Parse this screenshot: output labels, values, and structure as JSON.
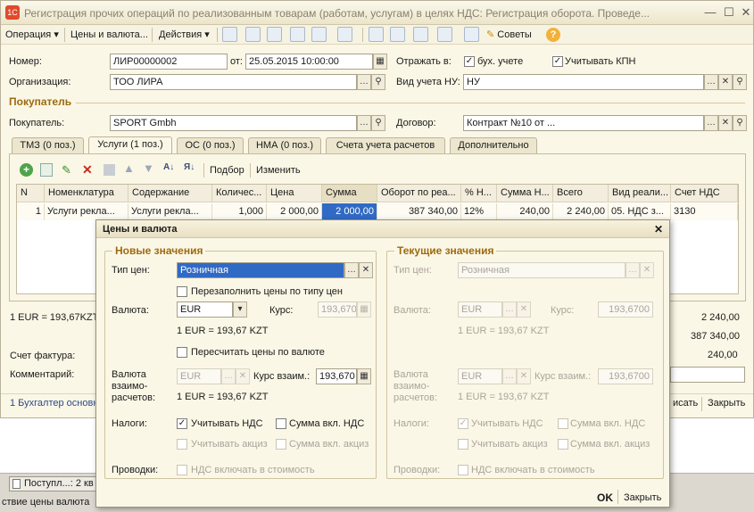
{
  "window": {
    "title": "Регистрация прочих операций по реализованным товарам (работам, услугам) в целях НДС: Регистрация оборота. Проведе...",
    "controls": {
      "minimize": "—",
      "maximize": "☐",
      "close": "✕"
    }
  },
  "toolbar": {
    "operation": "Операция",
    "prices": "Цены и валюта...",
    "actions": "Действия",
    "advice": "Советы",
    "help": "?"
  },
  "header": {
    "number_label": "Номер:",
    "number_value": "ЛИР00000002",
    "from_label": "от:",
    "date_value": "25.05.2015 10:00:00",
    "reflect_label": "Отражать в:",
    "bu_label": "бух. учете",
    "kpn_label": "Учитывать КПН",
    "org_label": "Организация:",
    "org_value": "ТОО ЛИРА",
    "nu_label": "Вид учета НУ:",
    "nu_value": "НУ",
    "buyer_section": "Покупатель",
    "buyer_label": "Покупатель:",
    "buyer_value": "SPORT Gmbh",
    "contract_label": "Договор:",
    "contract_value": "Контракт №10 от ..."
  },
  "tabs": [
    {
      "label": "ТМЗ (0 поз.)"
    },
    {
      "label": "Услуги (1 поз.)"
    },
    {
      "label": "ОС (0 поз.)"
    },
    {
      "label": "НМА (0 поз.)"
    },
    {
      "label": "Счета учета расчетов"
    },
    {
      "label": "Дополнительно"
    }
  ],
  "table_toolbar": {
    "pick": "Подбор",
    "change": "Изменить"
  },
  "table": {
    "columns": [
      "N",
      "Номенклатура",
      "Содержание",
      "Количес...",
      "Цена",
      "Сумма",
      "Оборот по реа...",
      "% Н...",
      "Сумма Н...",
      "Всего",
      "Вид реали...",
      "Счет НДС"
    ],
    "rows": [
      [
        "1",
        "Услуги рекла...",
        "Услуги рекла...",
        "1,000",
        "2 000,00",
        "2 000,00",
        "387 340,00",
        "12%",
        "240,00",
        "2 240,00",
        "05. НДС з...",
        "3130"
      ]
    ]
  },
  "footer": {
    "rate_text": "1 EUR = 193,67KZT",
    "total1": "2 240,00",
    "total2": "387 340,00",
    "total3": "240,00",
    "invoice_label": "Счет фактура:",
    "comment_label": "Комментарий:"
  },
  "statusbar": {
    "accountant": "1 Бухгалтер основн",
    "print": "исать",
    "close": "Закрыть"
  },
  "taskbar": {
    "item": "Поступл...: 2 кв",
    "hint": "ствие цены валюта"
  },
  "dialog": {
    "title": "Цены и валюта",
    "close": "✕",
    "new_title": "Новые значения",
    "current_title": "Текущие значения",
    "price_type_label": "Тип цен:",
    "price_type_value": "Розничная",
    "refill_label": "Перезаполнить цены по типу цен",
    "currency_label": "Валюта:",
    "currency_value": "EUR",
    "rate_label": "Курс:",
    "rate_value": "193,670",
    "rate_text": "1 EUR = 193,67 KZT",
    "recalc_label": "Пересчитать цены по валюте",
    "settle_label_1": "Валюта",
    "settle_label_2": "взаимо-",
    "settle_label_3": "расчетов:",
    "settle_currency": "EUR",
    "settle_rate_label": "Курс взаим.:",
    "settle_rate_value": "193,670",
    "taxes_label": "Налоги:",
    "vat_label": "Учитывать НДС",
    "vat_incl_label": "Сумма вкл. НДС",
    "excise_label": "Учитывать акциз",
    "excise_incl_label": "Сумма вкл. акциз",
    "postings_label": "Проводки:",
    "vat_cost_label": "НДС включать в стоимость",
    "cur_price_type": "Розничная",
    "cur_currency": "EUR",
    "cur_rate": "193,6700",
    "cur_settle_currency": "EUR",
    "cur_settle_rate": "193,6700",
    "ok": "OK",
    "close_btn": "Закрыть"
  }
}
